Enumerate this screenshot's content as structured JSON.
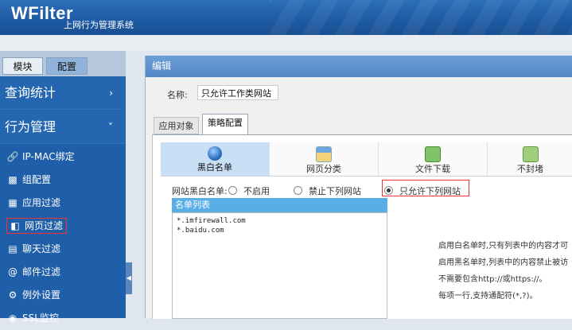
{
  "app": {
    "logo": "WFilter",
    "subtitle": "上网行为管理系统"
  },
  "sidebar": {
    "tabs": [
      "模块",
      "配置"
    ],
    "groups": [
      {
        "label": "查询统计",
        "chevron": "›"
      },
      {
        "label": "行为管理",
        "chevron": "˅"
      }
    ],
    "items": [
      {
        "icon": "link-icon",
        "label": "IP-MAC绑定"
      },
      {
        "icon": "group-icon",
        "label": "组配置"
      },
      {
        "icon": "apps-icon",
        "label": "应用过滤"
      },
      {
        "icon": "document-icon",
        "label": "网页过滤"
      },
      {
        "icon": "chat-icon",
        "label": "聊天过滤"
      },
      {
        "icon": "at-icon",
        "label": "邮件过滤"
      },
      {
        "icon": "gear-icon",
        "label": "例外设置"
      },
      {
        "icon": "lock-icon",
        "label": "SSL监控"
      }
    ]
  },
  "dialog": {
    "title": "编辑",
    "name_label": "名称:",
    "name_value": "只允许工作类网站",
    "tabs": [
      "应用对象",
      "策略配置"
    ],
    "subtabs": [
      "黑白名单",
      "网页分类",
      "文件下载",
      "不封堵"
    ],
    "mode_label": "网站黑白名单:",
    "modes": [
      "不启用",
      "禁止下列网站",
      "只允许下列网站"
    ],
    "selected_mode": "只允许下列网站",
    "list_header": "名单列表",
    "list_entries": [
      "*.imfirewall.com",
      "*.baidu.com"
    ],
    "help_lines": [
      "启用白名单时,只有列表中的内容才可",
      "启用黑名单时,列表中的内容禁止被访",
      "不需要包含http://或https://。",
      "每项一行,支持通配符(*,?)。"
    ]
  }
}
